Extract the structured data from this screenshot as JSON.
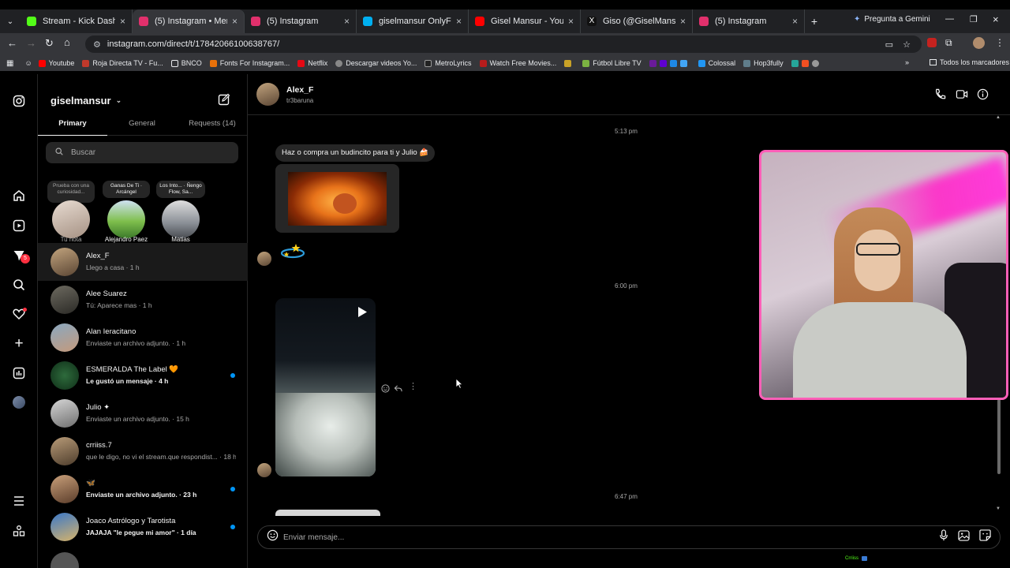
{
  "browser": {
    "tabs": [
      {
        "title": "Stream - Kick Dashboard",
        "color": "#53fc18"
      },
      {
        "title": "(5) Instagram • Mensajes",
        "color": "#e1306c",
        "active": true
      },
      {
        "title": "(5) Instagram",
        "color": "#e1306c"
      },
      {
        "title": "giselmansur OnlyFans Offi...",
        "color": "#00aff0"
      },
      {
        "title": "Gisel Mansur - YouTube",
        "color": "#ff0000"
      },
      {
        "title": "Giso (@GiselMansur) / X",
        "color": "#ffffff"
      },
      {
        "title": "(5) Instagram",
        "color": "#e1306c"
      }
    ],
    "gemini": "Pregunta a Gemini",
    "url": "instagram.com/direct/t/17842066100638767/",
    "bookmarks": [
      "Youtube",
      "Roja Directa TV - Fu...",
      "BNCO",
      "Fonts For Instagram...",
      "Netflix",
      "Descargar videos Yo...",
      "MetroLyrics",
      "Watch Free Movies...",
      "Fútbol Libre TV",
      "Colossal",
      "Hop3fully"
    ],
    "all_bookmarks": "Todos los marcadores"
  },
  "sidebar": {
    "username": "giselmansur",
    "tabs": [
      "Primary",
      "General",
      "Requests (14)"
    ],
    "search_placeholder": "Buscar",
    "notes": [
      {
        "note": "Prueba con una curiosidad...",
        "name": "Tu nota"
      },
      {
        "note": "Ganas De Ti · Arcángel",
        "name": "Alejandro Paez"
      },
      {
        "note": "Los Into... · Ñengo Flow, Sa...",
        "name": "Matias"
      }
    ],
    "conversations": [
      {
        "name": "Alex_F",
        "preview": "Llego a casa · 1 h",
        "selected": true
      },
      {
        "name": "Alee Suarez",
        "preview": "Tú: Aparece mas · 1 h"
      },
      {
        "name": "Alan Ieracitano",
        "preview": "Enviaste un archivo adjunto. · 1 h"
      },
      {
        "name": "ESMERALDA The Label 🧡",
        "preview": "Le gustó un mensaje · 4 h",
        "unread": true
      },
      {
        "name": "Julio ✦",
        "preview": "Enviaste un archivo adjunto. · 15 h"
      },
      {
        "name": "crriiss.7",
        "preview": "que le digo, no vi el stream.que respondist... · 18 h"
      },
      {
        "name": "🦋",
        "preview": "Enviaste un archivo adjunto. · 23 h",
        "unread": true
      },
      {
        "name": "Joaco Astrólogo y Tarotista",
        "preview": "JAJAJA \"le pegue mi amor\" · 1 día",
        "unread": true
      }
    ],
    "notif_badge": "5"
  },
  "chat": {
    "name": "Alex_F",
    "handle": "tr3baruna",
    "times": [
      "5:13 pm",
      "6:00 pm",
      "6:47 pm"
    ],
    "message": "Haz o compra un budincito para ti y Julio 🍰",
    "composer_placeholder": "Enviar mensaje..."
  },
  "footer_label": "Crriiss"
}
